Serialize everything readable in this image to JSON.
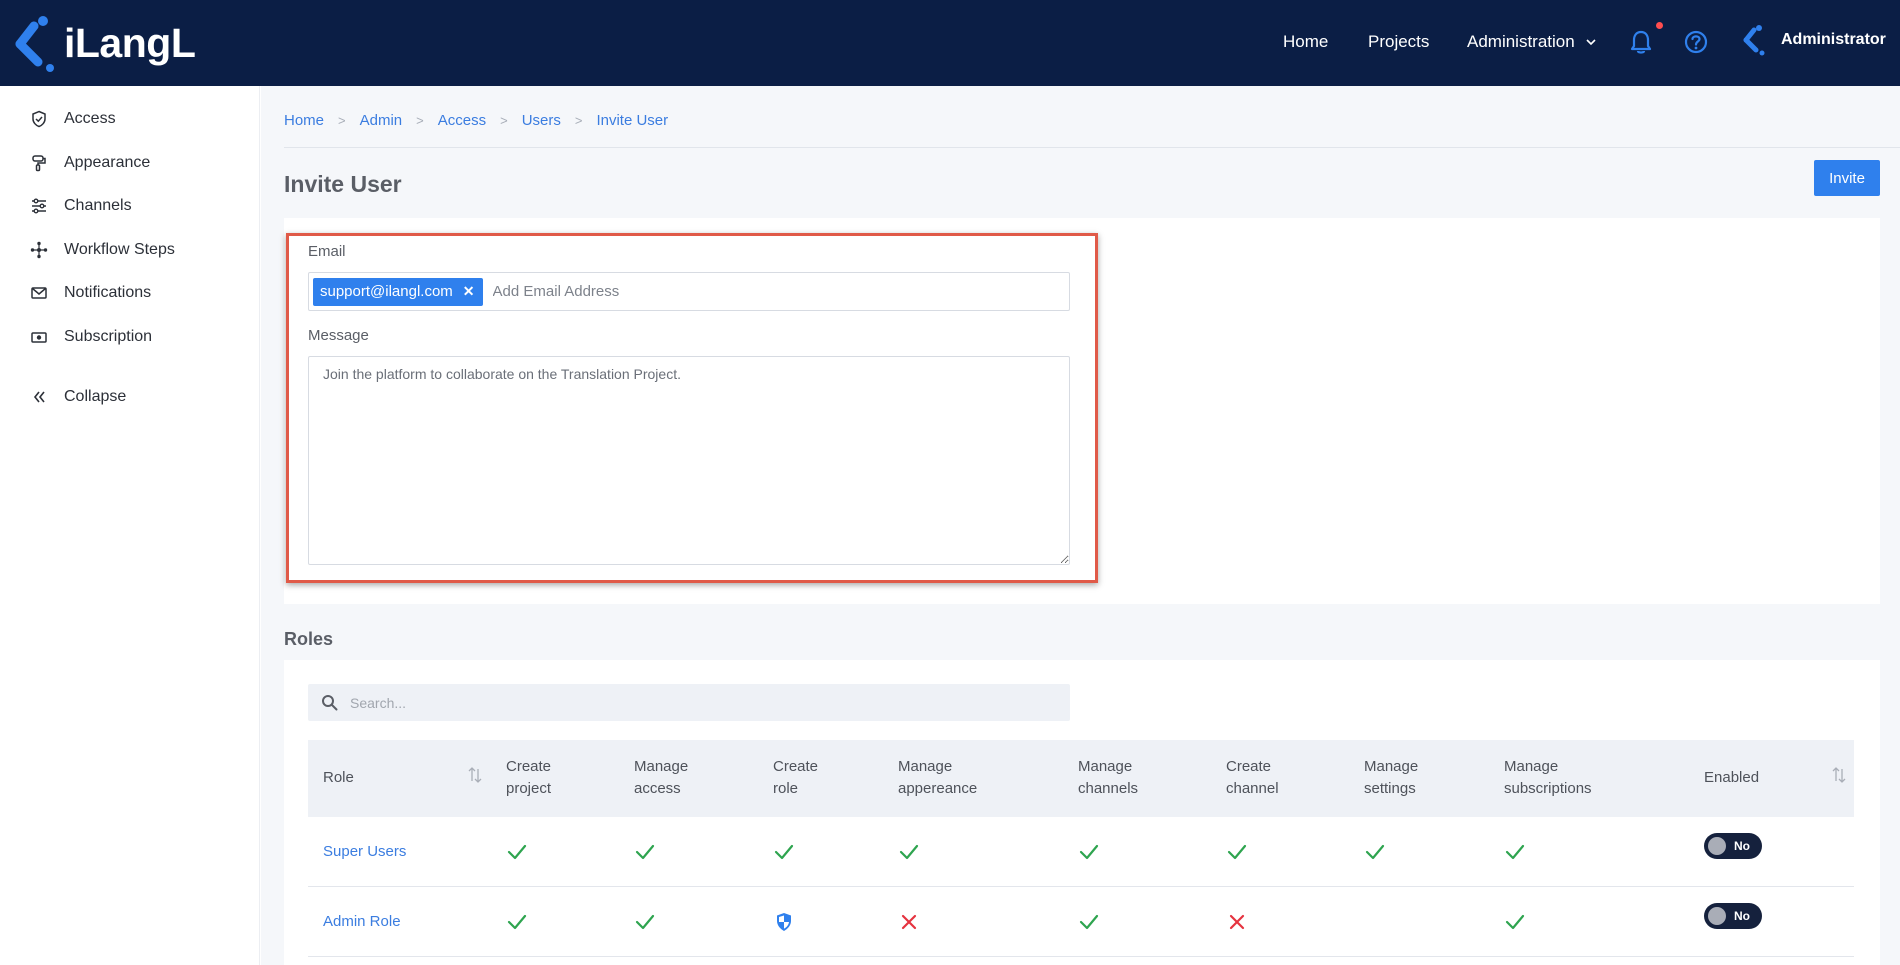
{
  "header": {
    "logo_text": "iLangL",
    "nav": {
      "home": "Home",
      "projects": "Projects",
      "administration": "Administration"
    },
    "user_name": "Administrator",
    "notification_dot_color": "#ff4d4f",
    "header_bg": "#0b1e45"
  },
  "sidebar": {
    "items": [
      {
        "label": "Access",
        "icon": "shield-check-icon"
      },
      {
        "label": "Appearance",
        "icon": "paint-roller-icon"
      },
      {
        "label": "Channels",
        "icon": "channels-icon"
      },
      {
        "label": "Workflow Steps",
        "icon": "workflow-icon"
      },
      {
        "label": "Notifications",
        "icon": "envelope-icon"
      },
      {
        "label": "Subscription",
        "icon": "money-icon"
      }
    ],
    "collapse_label": "Collapse"
  },
  "breadcrumb": [
    "Home",
    "Admin",
    "Access",
    "Users",
    "Invite User"
  ],
  "page": {
    "title": "Invite User",
    "invite_button": "Invite",
    "accent_color": "#2f80ed"
  },
  "form": {
    "email_label": "Email",
    "email_chip": "support@ilangl.com",
    "email_placeholder": "Add Email Address",
    "message_label": "Message",
    "message_value": "Join the platform to collaborate on the Translation Project.",
    "highlight_color": "#e05a48"
  },
  "roles": {
    "title": "Roles",
    "search_placeholder": "Search...",
    "columns": [
      {
        "line1": "Role",
        "line2": ""
      },
      {
        "line1": "Create",
        "line2": "project"
      },
      {
        "line1": "Manage",
        "line2": "access"
      },
      {
        "line1": "Create",
        "line2": "role"
      },
      {
        "line1": "Manage",
        "line2": "appereance"
      },
      {
        "line1": "Manage",
        "line2": "channels"
      },
      {
        "line1": "Create",
        "line2": "channel"
      },
      {
        "line1": "Manage",
        "line2": "settings"
      },
      {
        "line1": "Manage",
        "line2": "subscriptions"
      },
      {
        "line1": "Enabled",
        "line2": ""
      }
    ],
    "rows": [
      {
        "name": "Super Users",
        "cells": [
          "check",
          "check",
          "check",
          "check",
          "check",
          "check",
          "check",
          "check"
        ],
        "enabled": "No"
      },
      {
        "name": "Admin Role",
        "cells": [
          "check",
          "check",
          "shield",
          "cross",
          "check",
          "cross",
          "none",
          "check"
        ],
        "enabled": "No"
      }
    ],
    "status_colors": {
      "check": "#2ea44f",
      "cross": "#e5333f",
      "shield": "#2f80ed"
    }
  }
}
